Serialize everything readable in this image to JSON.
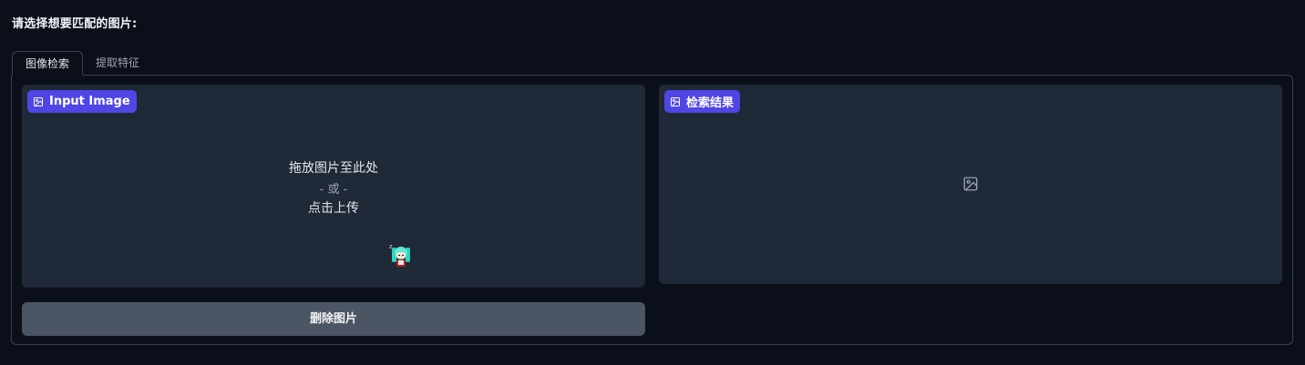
{
  "heading": "请选择想要匹配的图片:",
  "tabs": [
    {
      "label": "图像检索",
      "active": true
    },
    {
      "label": "提取特征",
      "active": false
    }
  ],
  "input_image": {
    "label": "Input Image",
    "label_icon": "image-icon",
    "drop_line1": "拖放图片至此处",
    "drop_or": "- 或 -",
    "drop_line2": "点击上传",
    "mascot_icon": "chibi-character-icon"
  },
  "result": {
    "label": "检索结果",
    "label_icon": "image-icon",
    "placeholder_icon": "image-placeholder-icon"
  },
  "delete_button": "删除图片",
  "colors": {
    "background": "#0b0f19",
    "block": "#1f2937",
    "accent": "#4f46e5",
    "button": "#4b5563",
    "border": "#374151"
  }
}
